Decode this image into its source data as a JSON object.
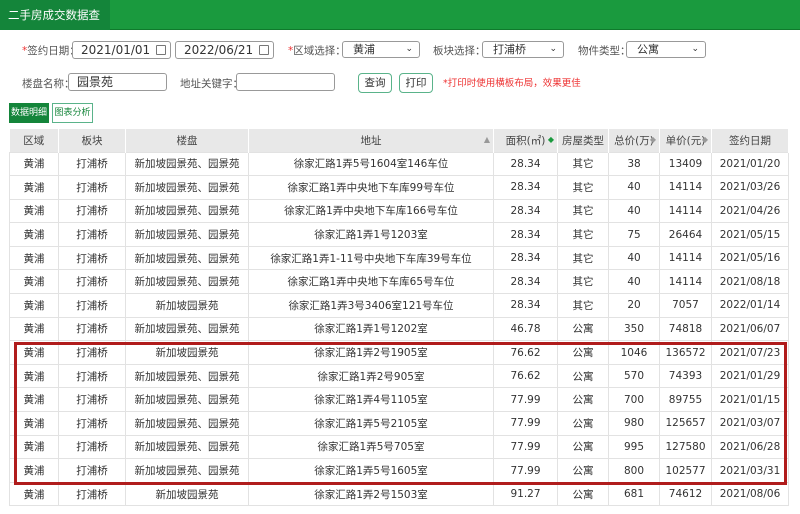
{
  "title": "二手房成交数据查询",
  "filters": {
    "date_label": "签约日期：",
    "date_from": "2021/01/01",
    "date_to": "2022/06/21",
    "district_label": "区域选择：",
    "district": "黄浦",
    "block_label": "板块选择：",
    "block": "打浦桥",
    "type_label": "物件类型：",
    "type": "公寓",
    "estate_label": "楼盘名称：",
    "estate": "园景苑",
    "address_label": "地址关键字：",
    "address": "",
    "query_button": "查询",
    "print_button": "打印",
    "print_note": "*打印时使用横板布局，效果更佳"
  },
  "tabs": [
    "数据明细",
    "图表分析"
  ],
  "columns": [
    "区域",
    "板块",
    "楼盘",
    "地址",
    "面积(㎡)",
    "房屋类型",
    "总价(万)",
    "单价(元)",
    "签约日期"
  ],
  "rows": [
    [
      "黄浦",
      "打浦桥",
      "新加坡园景苑、园景苑",
      "徐家汇路1弄5号1604室146车位",
      "28.34",
      "其它",
      "38",
      "13409",
      "2021/01/20"
    ],
    [
      "黄浦",
      "打浦桥",
      "新加坡园景苑、园景苑",
      "徐家汇路1弄中央地下车库99号车位",
      "28.34",
      "其它",
      "40",
      "14114",
      "2021/03/26"
    ],
    [
      "黄浦",
      "打浦桥",
      "新加坡园景苑、园景苑",
      "徐家汇路1弄中央地下车库166号车位",
      "28.34",
      "其它",
      "40",
      "14114",
      "2021/04/26"
    ],
    [
      "黄浦",
      "打浦桥",
      "新加坡园景苑、园景苑",
      "徐家汇路1弄1号1203室",
      "28.34",
      "其它",
      "75",
      "26464",
      "2021/05/15"
    ],
    [
      "黄浦",
      "打浦桥",
      "新加坡园景苑、园景苑",
      "徐家汇路1弄1-11号中央地下车库39号车位",
      "28.34",
      "其它",
      "40",
      "14114",
      "2021/05/16"
    ],
    [
      "黄浦",
      "打浦桥",
      "新加坡园景苑、园景苑",
      "徐家汇路1弄中央地下车库65号车位",
      "28.34",
      "其它",
      "40",
      "14114",
      "2021/08/18"
    ],
    [
      "黄浦",
      "打浦桥",
      "新加坡园景苑",
      "徐家汇路1弄3号3406室121号车位",
      "28.34",
      "其它",
      "20",
      "7057",
      "2022/01/14"
    ],
    [
      "黄浦",
      "打浦桥",
      "新加坡园景苑、园景苑",
      "徐家汇路1弄1号1202室",
      "46.78",
      "公寓",
      "350",
      "74818",
      "2021/06/07"
    ],
    [
      "黄浦",
      "打浦桥",
      "新加坡园景苑",
      "徐家汇路1弄2号1905室",
      "76.62",
      "公寓",
      "1046",
      "136572",
      "2021/07/23"
    ],
    [
      "黄浦",
      "打浦桥",
      "新加坡园景苑、园景苑",
      "徐家汇路1弄2号905室",
      "76.62",
      "公寓",
      "570",
      "74393",
      "2021/01/29"
    ],
    [
      "黄浦",
      "打浦桥",
      "新加坡园景苑、园景苑",
      "徐家汇路1弄4号1105室",
      "77.99",
      "公寓",
      "700",
      "89755",
      "2021/01/15"
    ],
    [
      "黄浦",
      "打浦桥",
      "新加坡园景苑、园景苑",
      "徐家汇路1弄5号2105室",
      "77.99",
      "公寓",
      "980",
      "125657",
      "2021/03/07"
    ],
    [
      "黄浦",
      "打浦桥",
      "新加坡园景苑、园景苑",
      "徐家汇路1弄5号705室",
      "77.99",
      "公寓",
      "995",
      "127580",
      "2021/06/28"
    ],
    [
      "黄浦",
      "打浦桥",
      "新加坡园景苑、园景苑",
      "徐家汇路1弄5号1605室",
      "77.99",
      "公寓",
      "800",
      "102577",
      "2021/03/31"
    ],
    [
      "黄浦",
      "打浦桥",
      "新加坡园景苑",
      "徐家汇路1弄2号1503室",
      "91.27",
      "公寓",
      "681",
      "74612",
      "2021/08/06"
    ]
  ]
}
